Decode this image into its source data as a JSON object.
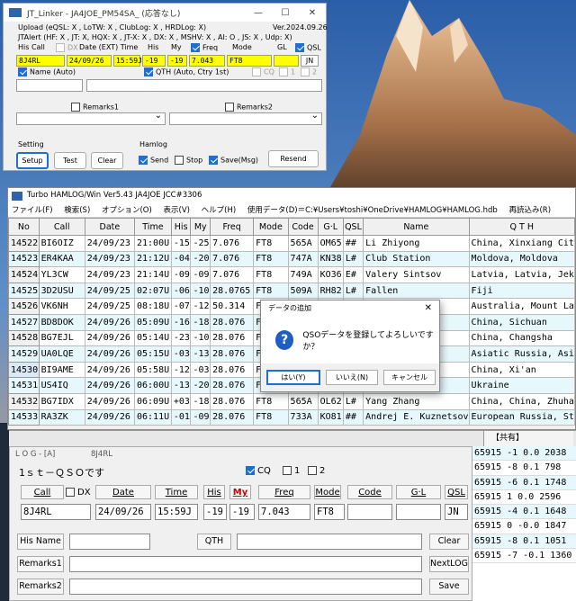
{
  "colors": {
    "yellow_field": "#ffff00",
    "accent": "#1f6fd0",
    "row_alt": "#e6f8fb"
  },
  "jt": {
    "title": "JT_Linker - JA4JOE_PM54SA_ (応答なし)",
    "line1": "Upload (eQSL: X , LoTW: X , ClubLog: X , HRDLog: X)",
    "version": "Ver.2024.09.26",
    "line2": "JTAlert (HF: X , JT: X, HQX: X , JT-X: X , DX: X , MSHV: X , AI: O , JS: X , Udp: X)",
    "header": {
      "hiscall": "His Call",
      "dx": "DX",
      "date": "Date (EXT) Time",
      "his": "His",
      "my": "My",
      "freq": "Freq",
      "mode": "Mode",
      "gl": "GL",
      "qsl": "QSL"
    },
    "values": {
      "call": "8J4RL",
      "date": "24/09/26",
      "time": "15:59J",
      "his": "-19",
      "my": "-19",
      "freq": "7.043",
      "mode": "FT8",
      "qsl": "JN"
    },
    "name_label": "Name (Auto)",
    "qth_label": "QTH (Auto, Ctry 1st)",
    "cq": "CQ",
    "one": "1",
    "two": "2",
    "remarks1": "Remarks1",
    "remarks2": "Remarks2",
    "setting": "Setting",
    "setup": "Setup",
    "test": "Test",
    "clear": "Clear",
    "hamlog": "Hamlog",
    "send": "Send",
    "stop": "Stop",
    "savemsg": "Save(Msg)",
    "resend": "Resend",
    "win_min": "—",
    "win_max": "☐",
    "win_close": "✕"
  },
  "hamlog": {
    "title": "Turbo HAMLOG/Win Ver5.43 JA4JOE JCC#3306",
    "menu": [
      "ファイル(F)",
      "検索(S)",
      "オプション(O)",
      "表示(V)",
      "ヘルプ(H)",
      "使用データ(D)＝C:¥Users¥toshi¥OneDrive¥HAMLOG¥HAMLOG.hdb",
      "再読込み(R)"
    ],
    "headers": [
      "No",
      "Call",
      "Date",
      "Time",
      "His",
      "My",
      "Freq",
      "Mode",
      "Code",
      "G·L",
      "QSL",
      "Name",
      "Q T H"
    ],
    "rows": [
      [
        "14522",
        "BI6OIZ",
        "24/09/23",
        "21:00U",
        "-15",
        "-25",
        "7.076",
        "FT8",
        "565A",
        "OM65",
        "##",
        "Li Zhiyong",
        "China, Xinxiang Cit"
      ],
      [
        "14523",
        "ER4KAA",
        "24/09/23",
        "21:12U",
        "-04",
        "-20",
        "7.076",
        "FT8",
        "747A",
        "KN38",
        "L#",
        "Club Station",
        "Moldova, Moldova"
      ],
      [
        "14524",
        "YL3CW",
        "24/09/23",
        "21:14U",
        "-09",
        "-09",
        "7.076",
        "FT8",
        "749A",
        "KO36",
        "E#",
        "Valery Sintsov",
        "Latvia, Latvia, Jek"
      ],
      [
        "14525",
        "3D2USU",
        "24/09/25",
        "02:07U",
        "-06",
        "-10",
        "28.0765",
        "FT8",
        "509A",
        "RH82",
        "L#",
        "Fallen",
        "Fiji"
      ],
      [
        "14526",
        "VK6NH",
        "24/09/25",
        "08:18U",
        "-07",
        "-12",
        "50.314",
        "FT8",
        "",
        "",
        "",
        "",
        "Australia, Mount La"
      ],
      [
        "14527",
        "BD8DOK",
        "24/09/26",
        "05:09U",
        "-16",
        "-18",
        "28.076",
        "FT8",
        "",
        "",
        "",
        "",
        "China, Sichuan"
      ],
      [
        "14528",
        "BG7EJL",
        "24/09/26",
        "05:14U",
        "-23",
        "-10",
        "28.076",
        "FT8",
        "",
        "",
        "",
        "",
        "China, Changsha"
      ],
      [
        "14529",
        "UA0LQE",
        "24/09/26",
        "05:15U",
        "-03",
        "-13",
        "28.076",
        "FT8",
        "",
        "",
        "",
        "ly",
        "Asiatic Russia, Asi"
      ],
      [
        "14530",
        "BI9AME",
        "24/09/26",
        "05:58U",
        "-12",
        "-03",
        "28.076",
        "FT8",
        "",
        "",
        "",
        "",
        "China, Xi'an"
      ],
      [
        "14531",
        "US4IQ",
        "24/09/26",
        "06:00U",
        "-13",
        "-20",
        "28.076",
        "FT8",
        "",
        "",
        "",
        "vorov",
        "Ukraine"
      ],
      [
        "14532",
        "BG7IDX",
        "24/09/26",
        "06:09U",
        "+03",
        "-18",
        "28.076",
        "FT8",
        "565A",
        "OL62",
        "L#",
        "Yang Zhang",
        "China, China, Zhuha"
      ],
      [
        "14533",
        "RA3ZK",
        "24/09/26",
        "06:11U",
        "-01",
        "-09",
        "28.076",
        "FT8",
        "733A",
        "KO81",
        "##",
        "Andrej E. Kuznetsov",
        "European Russia, St"
      ]
    ]
  },
  "dialog": {
    "title": "データの追加",
    "message": "QSOデータを登録してよろしいですか？",
    "yes": "はい(Y)",
    "no": "いいえ(N)",
    "cancel": "キャンセル",
    "close": "✕"
  },
  "loga": {
    "title": "L O G - [A]",
    "call_title": "8J4RL",
    "first_qso": "1ｓｔ－ＱＳＯです",
    "cq": "CQ",
    "one": "1",
    "two": "2",
    "labels": {
      "call": "Call",
      "dx": "DX",
      "date": "Date",
      "time": "Time",
      "his": "His",
      "my": "My",
      "freq": "Freq",
      "mode": "Mode",
      "code": "Code",
      "gl": "G·L",
      "qsl": "QSL"
    },
    "values": {
      "call": "8J4RL",
      "date": "24/09/26",
      "time": "15:59J",
      "his": "-19",
      "my": "-19",
      "freq": "7.043",
      "mode": "FT8",
      "code": "",
      "gl": "",
      "qsl": "JN"
    },
    "his_name": "His Name",
    "qth": "QTH",
    "clear": "Clear",
    "remarks1": "Remarks1",
    "nextlog": "NextLOG",
    "remarks2": "Remarks2",
    "save": "Save"
  },
  "shared_tab": "【共有】",
  "right_rows": [
    "65915 -1  0.0 2038",
    "65915 -8  0.1  798",
    "65915 -6  0.1 1748",
    "65915  1  0.0 2596",
    "65915 -4  0.1 1648",
    "65915  0 -0.0 1847",
    "65915 -8  0.1 1051",
    "65915 -7 -0.1 1360"
  ]
}
